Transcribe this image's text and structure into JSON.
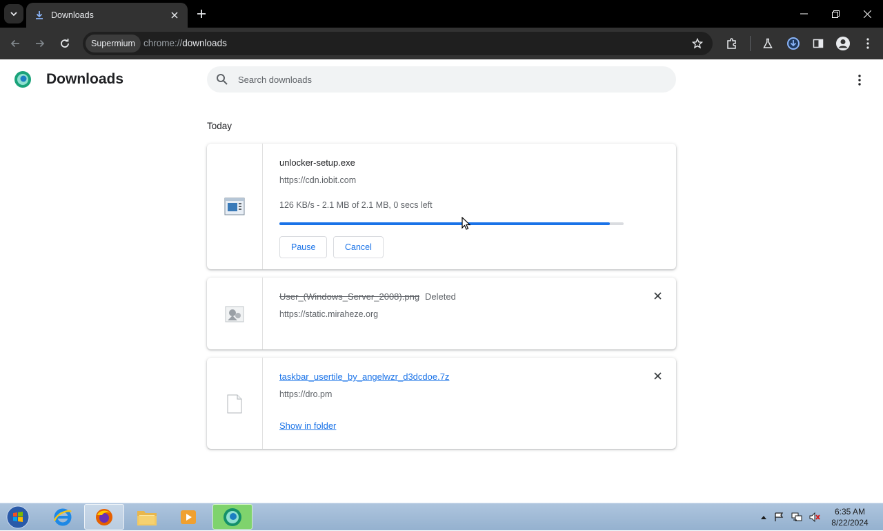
{
  "browser": {
    "tab_title": "Downloads",
    "profile_chip": "Supermium",
    "url_scheme": "chrome://",
    "url_host": "downloads"
  },
  "page": {
    "title": "Downloads",
    "search_placeholder": "Search downloads",
    "date_header": "Today"
  },
  "downloads": [
    {
      "filename": "unlocker-setup.exe",
      "url": "https://cdn.iobit.com",
      "progress_text": "126 KB/s - 2.1 MB of 2.1 MB, 0 secs left",
      "progress_fraction": 0.96,
      "pause_label": "Pause",
      "cancel_label": "Cancel"
    },
    {
      "filename": "User_(Windows_Server_2008).png",
      "status": "Deleted",
      "url": "https://static.miraheze.org"
    },
    {
      "filename": "taskbar_usertile_by_angelwzr_d3dcdoe.7z",
      "url": "https://dro.pm",
      "action_label": "Show in folder"
    }
  ],
  "taskbar": {
    "time": "6:35 AM",
    "date": "8/22/2024"
  },
  "colors": {
    "accent": "#1a73e8",
    "toolbar": "#323232",
    "titlebar": "#000000"
  }
}
